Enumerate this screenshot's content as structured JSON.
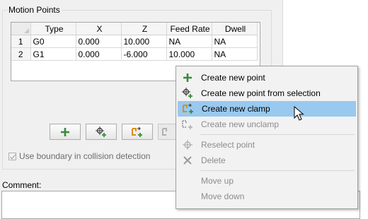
{
  "motion_points": {
    "title": "Motion Points",
    "columns": [
      "",
      "Type",
      "X",
      "Z",
      "Feed Rate",
      "Dwell"
    ],
    "rows": [
      [
        "1",
        "G0",
        "0.000",
        "10.000",
        "NA",
        "NA"
      ],
      [
        "2",
        "G1",
        "0.000",
        "-6.000",
        "10.000",
        "NA"
      ]
    ]
  },
  "toolbar": {
    "buttons": [
      {
        "icon": "plus-icon"
      },
      {
        "icon": "point-from-selection-icon"
      },
      {
        "icon": "clamp-icon"
      },
      {
        "icon": "unclamp-icon"
      }
    ]
  },
  "boundary_checkbox": {
    "label": "Use boundary in collision detection",
    "checked": true,
    "enabled": false
  },
  "comment": {
    "label": "Comment:",
    "value": ""
  },
  "context_menu": {
    "items": [
      {
        "label": "Create new point",
        "icon": "plus-icon",
        "enabled": true
      },
      {
        "label": "Create new point from selection",
        "icon": "point-from-selection-icon",
        "enabled": true
      },
      {
        "label": "Create new clamp",
        "icon": "clamp-icon",
        "enabled": true,
        "highlighted": true
      },
      {
        "label": "Create new unclamp",
        "icon": "unclamp-icon",
        "enabled": false
      },
      {
        "label": "Reselect point",
        "icon": "crosshair-icon",
        "enabled": false
      },
      {
        "label": "Delete",
        "icon": "delete-icon",
        "enabled": false
      },
      {
        "label": "Move up",
        "enabled": false
      },
      {
        "label": "Move down",
        "enabled": false
      }
    ]
  },
  "colors": {
    "highlight": "#99c9ef",
    "plus_green": "#3a8a3a",
    "clamp_orange": "#e08a1e"
  }
}
